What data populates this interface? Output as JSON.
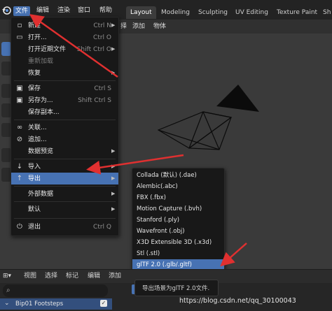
{
  "topbar": {
    "menus": [
      "文件",
      "编辑",
      "渲染",
      "窗口",
      "帮助"
    ],
    "workspaces": [
      "Layout",
      "Modeling",
      "Sculpting",
      "UV Editing",
      "Texture Paint",
      "Sh"
    ],
    "active_workspace": "Layout"
  },
  "viewport": {
    "header_menus": [
      "择",
      "添加",
      "物体"
    ]
  },
  "file_menu": {
    "items": [
      {
        "label": "新建",
        "shortcut": "Ctrl N",
        "icon": "new-file-icon",
        "submenu": true,
        "enabled": true
      },
      {
        "label": "打开...",
        "shortcut": "Ctrl O",
        "icon": "folder-icon",
        "submenu": false,
        "enabled": true
      },
      {
        "label": "打开近期文件",
        "shortcut": "Shift Ctrl O",
        "icon": "",
        "submenu": true,
        "enabled": true
      },
      {
        "label": "重新加载",
        "shortcut": "",
        "icon": "",
        "submenu": false,
        "enabled": false
      },
      {
        "label": "恢复",
        "shortcut": "",
        "icon": "",
        "submenu": true,
        "enabled": true
      },
      {
        "label": "保存",
        "shortcut": "Ctrl S",
        "icon": "save-icon",
        "submenu": false,
        "enabled": true
      },
      {
        "label": "另存为...",
        "shortcut": "Shift Ctrl S",
        "icon": "save-as-icon",
        "submenu": false,
        "enabled": true
      },
      {
        "label": "保存副本...",
        "shortcut": "",
        "icon": "",
        "submenu": false,
        "enabled": true
      },
      {
        "label": "关联...",
        "shortcut": "",
        "icon": "link-icon",
        "submenu": false,
        "enabled": true
      },
      {
        "label": "追加...",
        "shortcut": "",
        "icon": "append-icon",
        "submenu": false,
        "enabled": true
      },
      {
        "label": "数据预览",
        "shortcut": "",
        "icon": "",
        "submenu": true,
        "enabled": true
      },
      {
        "label": "导入",
        "shortcut": "",
        "icon": "import-icon",
        "submenu": true,
        "enabled": true
      },
      {
        "label": "导出",
        "shortcut": "",
        "icon": "export-icon",
        "submenu": true,
        "enabled": true,
        "highlighted": true
      },
      {
        "label": "外部数据",
        "shortcut": "",
        "icon": "",
        "submenu": true,
        "enabled": true
      },
      {
        "label": "默认",
        "shortcut": "",
        "icon": "",
        "submenu": true,
        "enabled": true
      },
      {
        "label": "退出",
        "shortcut": "Ctrl Q",
        "icon": "quit-icon",
        "submenu": false,
        "enabled": true
      }
    ]
  },
  "export_menu": {
    "items": [
      "Collada (默认) (.dae)",
      "Alembic(.abc)",
      "FBX (.fbx)",
      "Motion Capture (.bvh)",
      "Stanford (.ply)",
      "Wavefront (.obj)",
      "X3D Extensible 3D (.x3d)",
      "Stl (.stl)",
      "glTF 2.0 (.glb/.gltf)"
    ],
    "highlighted_index": 8
  },
  "tooltip": {
    "text": "导出场景为glTF 2.0文件."
  },
  "timeline": {
    "menus": [
      "视图",
      "选择",
      "标记",
      "编辑",
      "添加"
    ],
    "track_name": "Bip01 Footsteps"
  },
  "watermark": "https://blog.csdn.net/qq_30100043",
  "colors": {
    "accent": "#4772b3",
    "arrow": "#e03030",
    "menu_bg": "#181818",
    "viewport_bg": "#3a3a3a"
  }
}
